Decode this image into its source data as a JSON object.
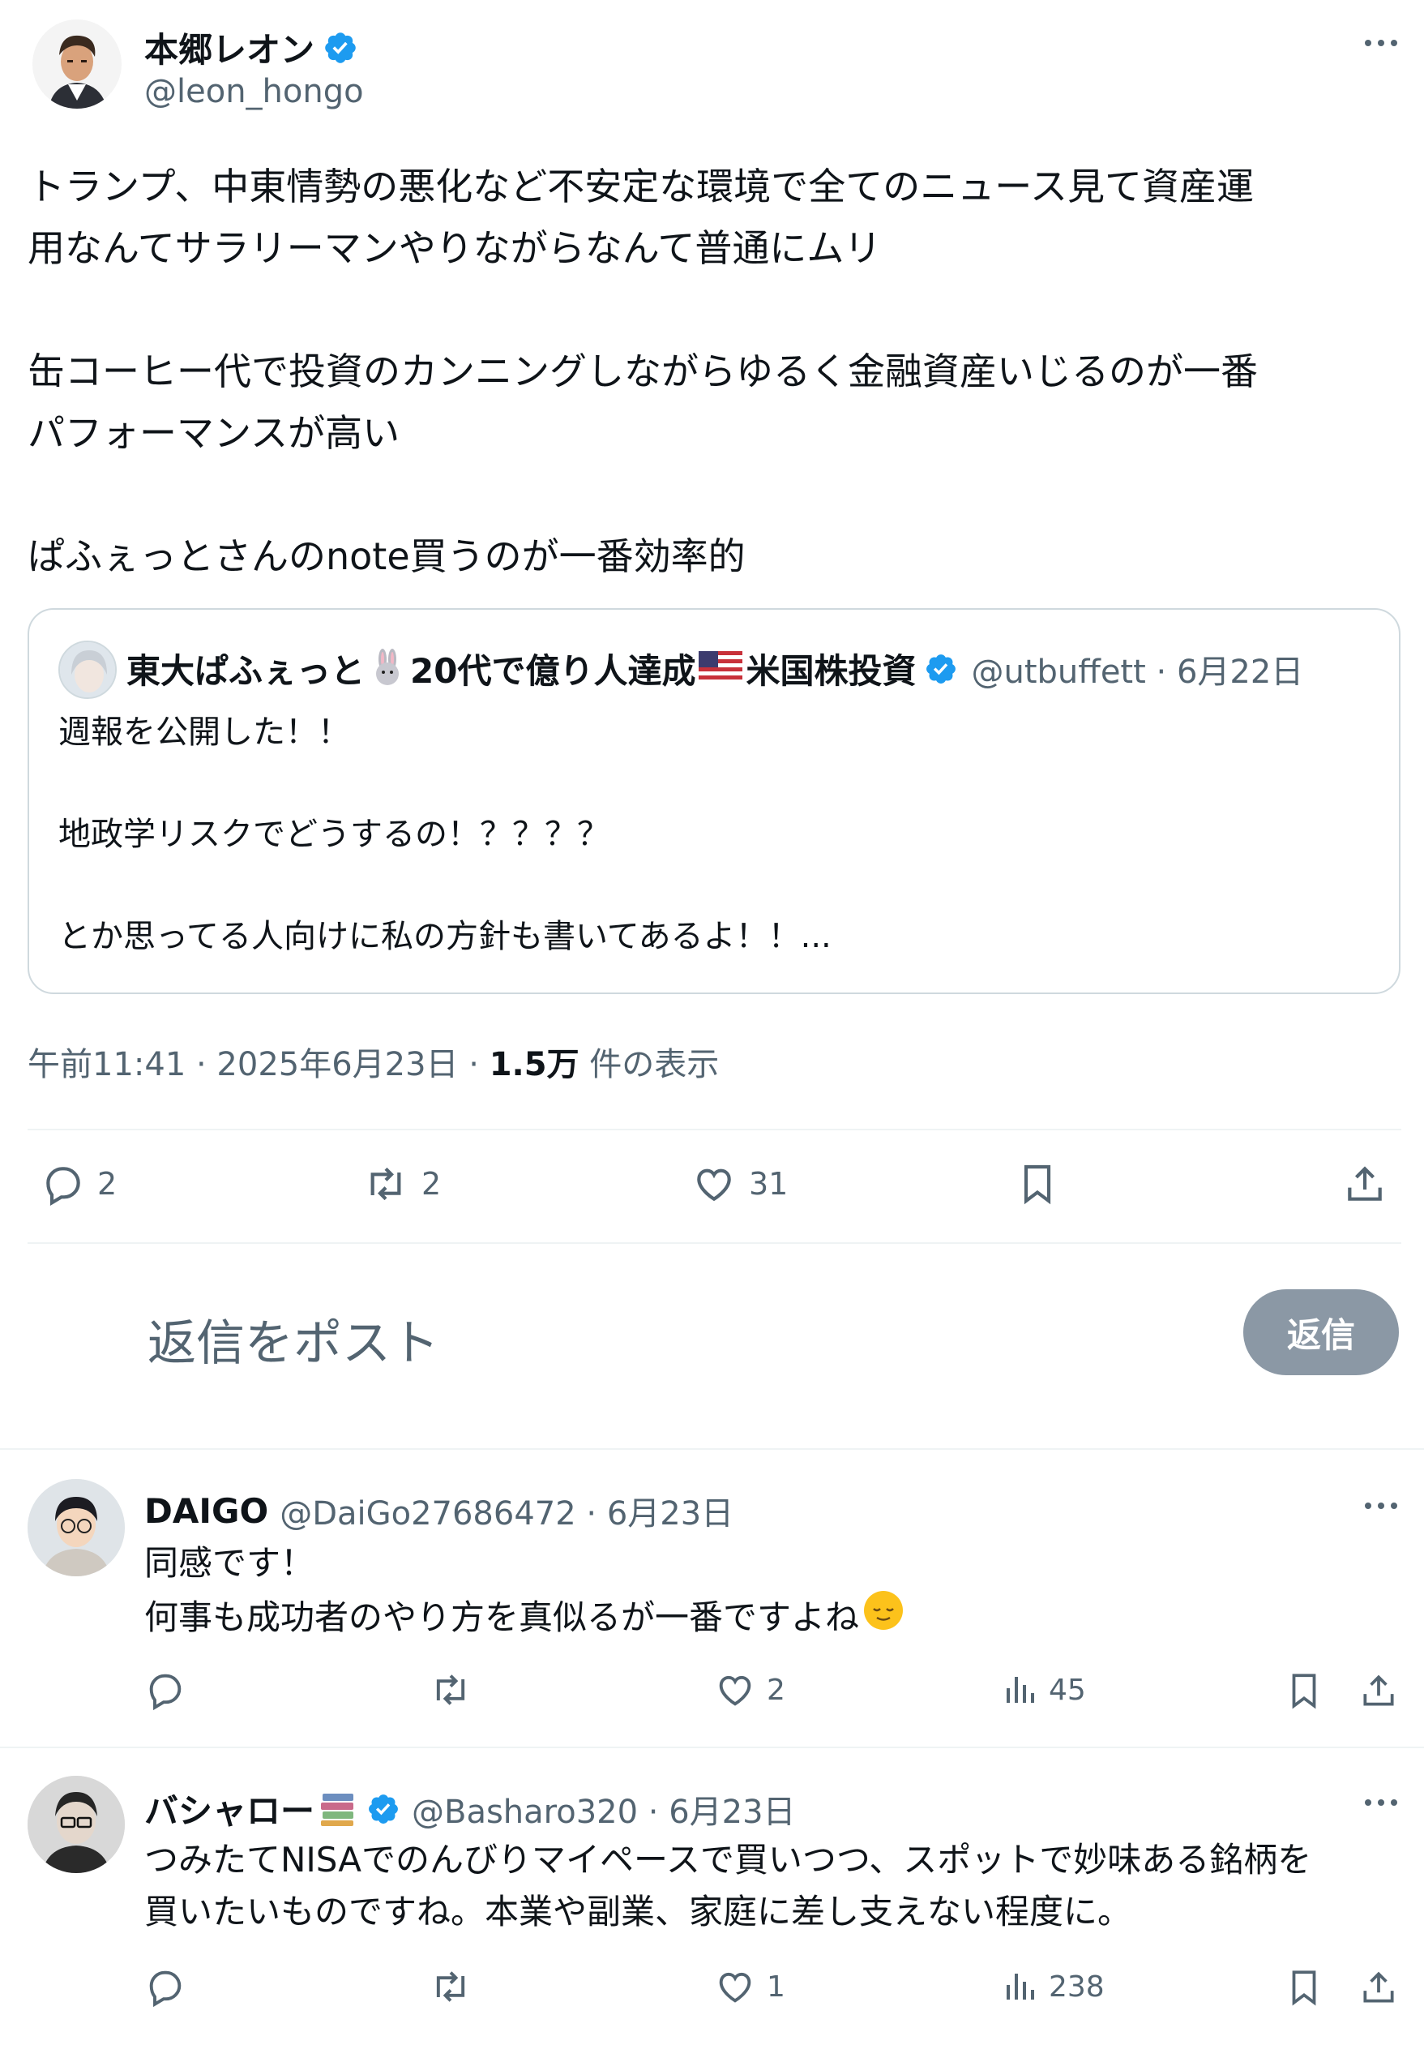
{
  "main_post": {
    "author_name": "本郷レオン",
    "author_handle": "@leon_hongo",
    "body_lines": [
      "トランプ、中東情勢の悪化など不安定な環境で全てのニュース見て資産運",
      "用なんてサラリーマンやりながらなんて普通にムリ",
      "",
      "缶コーヒー代で投資のカンニングしながらゆるく金融資産いじるのが一番",
      "パフォーマンスが高い",
      "",
      "ぱふぇっとさんのnote買うのが一番効率的"
    ],
    "quote": {
      "author_name_1": "東大ぱふぇっと",
      "author_name_2": "20代で億り人達成",
      "author_name_3": "米国株投資",
      "handle_date": "@utbuffett · 6月22日",
      "lines": [
        "週報を公開した！！",
        "",
        "地政学リスクでどうするの！？？？？",
        "",
        "とか思ってる人向けに私の方針も書いてあるよ！！..."
      ]
    },
    "meta_time": "午前11:41 · 2025年6月23日 · ",
    "meta_views": "1.5万",
    "meta_views_label": " 件の表示",
    "actions": {
      "reply_count": "2",
      "retweet_count": "2",
      "like_count": "31"
    }
  },
  "reply_box": {
    "placeholder": "返信をポスト",
    "button_label": "返信"
  },
  "replies": [
    {
      "name": "DAIGO",
      "handle_date": "@DaiGo27686472 · 6月23日",
      "lines": [
        "同感です！",
        "何事も成功者のやり方を真似るが一番ですよね"
      ],
      "like_count": "2",
      "views": "45"
    },
    {
      "name": "バシャロー",
      "handle_date": "@Basharo320 · 6月23日",
      "lines": [
        "つみたてNISAでのんびりマイペースで買いつつ、スポットで妙味ある銘柄を",
        "買いたいものですね。本業や副業、家庭に差し支えない程度に。"
      ],
      "like_count": "1",
      "views": "238"
    }
  ],
  "icons": {
    "more": "more-dots-icon",
    "verified": "verified-badge-icon",
    "reply": "reply-icon",
    "retweet": "retweet-icon",
    "like": "heart-icon",
    "bookmark": "bookmark-icon",
    "share": "share-icon",
    "views": "views-chart-icon"
  },
  "colors": {
    "verified": "#1d9bf0",
    "text": "#0f1419",
    "muted": "#536471",
    "reply_button_bg": "#8b98a5"
  }
}
